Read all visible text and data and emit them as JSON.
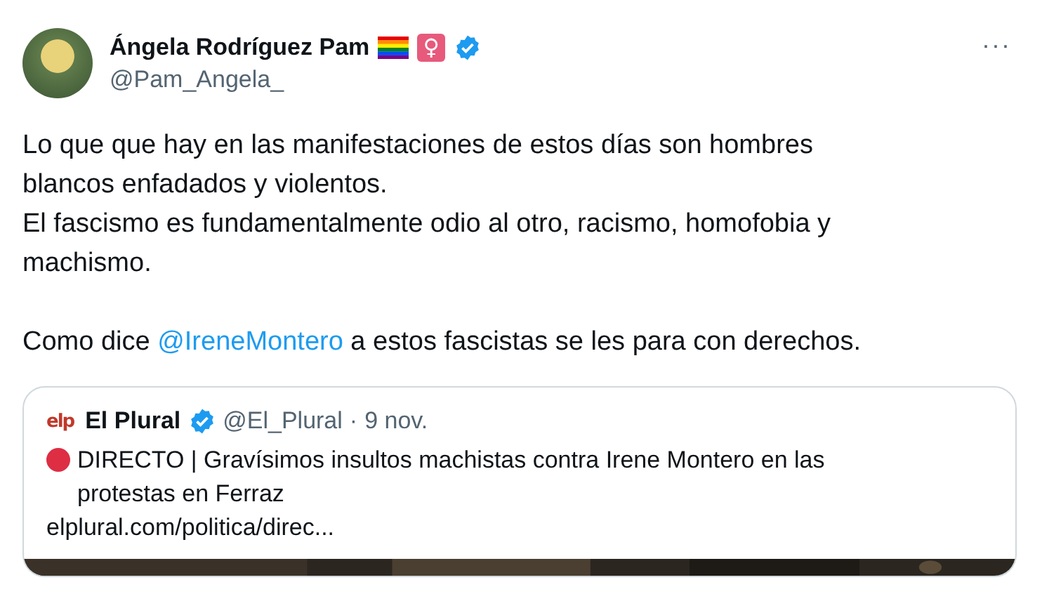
{
  "author": {
    "name": "Ángela Rodríguez Pam",
    "badge_symbol": "♀",
    "verified": true,
    "handle": "@Pam_Angela_"
  },
  "more_symbol": "···",
  "paragraphs": [
    {
      "parts": [
        {
          "kind": "text",
          "text": "Lo que que hay en las manifestaciones de estos días son hombres blancos enfadados y violentos."
        }
      ]
    },
    {
      "parts": [
        {
          "kind": "text",
          "text": "El fascismo es fundamentalmente odio al otro, racismo, homofobia y machismo."
        }
      ]
    },
    {
      "parts": [
        {
          "kind": "text",
          "text": "Como dice "
        },
        {
          "kind": "mention",
          "text": "@IreneMontero"
        },
        {
          "kind": "text",
          "text": " a estos fascistas se les para con derechos."
        }
      ]
    }
  ],
  "quote": {
    "logo_text": "elp",
    "name": "El Plural",
    "verified": true,
    "handle": "@El_Plural",
    "separator": "·",
    "date": "9 nov.",
    "text": "DIRECTO | Gravísimos insultos machistas contra Irene Montero en las protestas en Ferraz",
    "link": "elplural.com/politica/direc..."
  }
}
